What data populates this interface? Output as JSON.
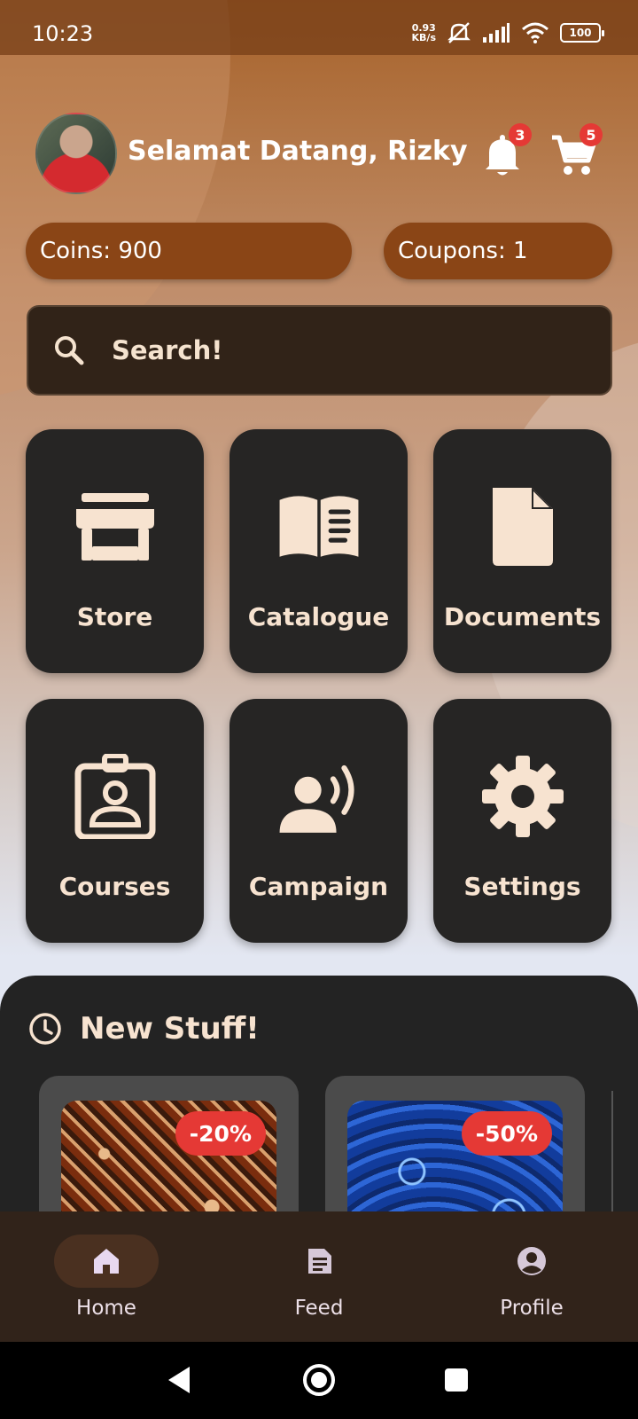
{
  "status_bar": {
    "time": "10:23",
    "net_speed_value": "0.93",
    "net_speed_unit": "KB/s",
    "battery": "100"
  },
  "header": {
    "greeting": "Selamat Datang, Rizky",
    "notification_count": "3",
    "cart_count": "5"
  },
  "balances": {
    "coins_label": "Coins: 900",
    "coupons_label": "Coupons: 1"
  },
  "search": {
    "placeholder": "Search!"
  },
  "menu": {
    "store": "Store",
    "catalogue": "Catalogue",
    "documents": "Documents",
    "courses": "Courses",
    "campaign": "Campaign",
    "settings": "Settings"
  },
  "new_stuff": {
    "title": "New Stuff!",
    "items": [
      {
        "discount": "-20%"
      },
      {
        "discount": "-50%"
      }
    ]
  },
  "bottom_nav": {
    "home": "Home",
    "feed": "Feed",
    "profile": "Profile"
  },
  "colors": {
    "accent_cream": "#F7E3D0",
    "tile_dark": "#262524",
    "pill_brown": "#8A4516",
    "badge_red": "#E53935"
  }
}
